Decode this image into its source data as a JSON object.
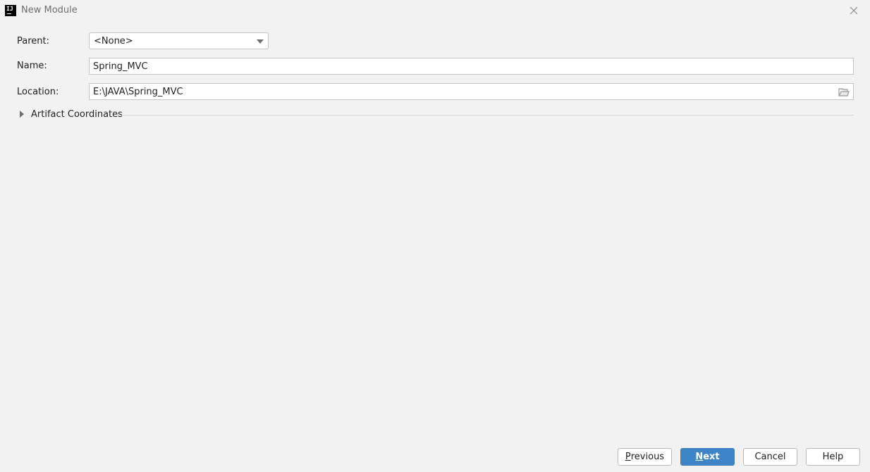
{
  "window": {
    "title": "New Module",
    "app_icon_text": "IJ",
    "close_icon": "close-icon"
  },
  "form": {
    "parent": {
      "label": "Parent:",
      "value": "<None>"
    },
    "name": {
      "label": "Name:",
      "value": "Spring_MVC"
    },
    "location": {
      "label": "Location:",
      "value": "E:\\JAVA\\Spring_MVC",
      "browse_icon": "folder-icon"
    }
  },
  "artifact": {
    "label": "Artifact Coordinates",
    "expanded": false
  },
  "buttons": {
    "previous": {
      "mnemonic": "P",
      "rest": "revious"
    },
    "next": {
      "mnemonic": "N",
      "rest": "ext"
    },
    "cancel": "Cancel",
    "help": "Help"
  },
  "colors": {
    "background": "#f2f2f2",
    "primary_button": "#3d85c6",
    "input_border": "#c4c4c4"
  }
}
